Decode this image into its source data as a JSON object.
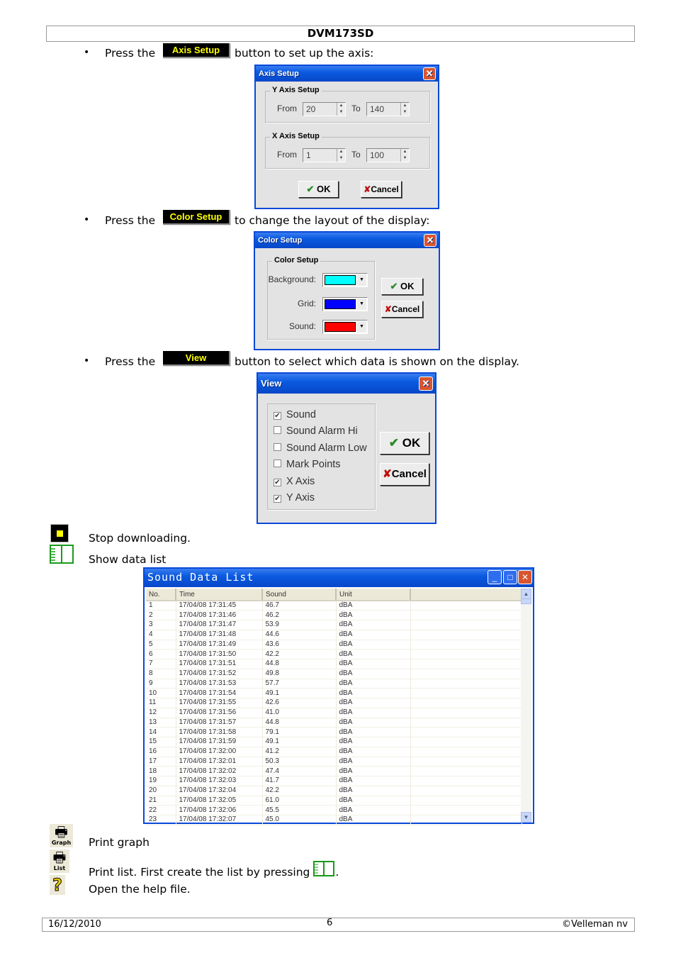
{
  "header": {
    "title": "DVM173SD"
  },
  "bullets": [
    {
      "prefix": "Press the",
      "button": "Axis Setup",
      "suffix": "button to set up the axis:"
    },
    {
      "prefix": "Press the",
      "button": "Color Setup",
      "suffix": "to change the layout of the display:"
    },
    {
      "prefix": "Press the",
      "button": "View",
      "suffix": "button to select which data is shown on the display."
    }
  ],
  "axis_dialog": {
    "title": "Axis Setup",
    "y_group": "Y Axis Setup",
    "x_group": "X Axis Setup",
    "from_label": "From",
    "to_label": "To",
    "y_from": "20",
    "y_to": "140",
    "x_from": "1",
    "x_to": "100",
    "ok": "OK",
    "cancel": "Cancel"
  },
  "color_dialog": {
    "title": "Color Setup",
    "group": "Color Setup",
    "background_label": "Background:",
    "grid_label": "Grid:",
    "sound_label": "Sound:",
    "background_color": "#00ffff",
    "grid_color": "#0000ff",
    "sound_color": "#ff0000",
    "ok": "OK",
    "cancel": "Cancel"
  },
  "view_dialog": {
    "title": "View",
    "options": [
      {
        "label": "Sound",
        "checked": true
      },
      {
        "label": "Sound Alarm Hi",
        "checked": false
      },
      {
        "label": "Sound Alarm Low",
        "checked": false
      },
      {
        "label": "Mark Points",
        "checked": false
      },
      {
        "label": "X Axis",
        "checked": true
      },
      {
        "label": "Y Axis",
        "checked": true
      }
    ],
    "ok": "OK",
    "cancel": "Cancel"
  },
  "icons": {
    "stop": "Stop downloading.",
    "show_list": "Show data list",
    "print_graph": "Print graph",
    "print_list": "Print list. First create the list by pressing",
    "print_list_end": ".",
    "help": "Open the help file.",
    "graph_caption": "Graph",
    "list_caption": "List"
  },
  "list_window": {
    "title": "Sound Data List",
    "columns": [
      "No.",
      "Time",
      "Sound",
      "Unit",
      ""
    ],
    "rows": [
      [
        "1",
        "17/04/08 17:31:45",
        "46.7",
        "dBA"
      ],
      [
        "2",
        "17/04/08 17:31:46",
        "46.2",
        "dBA"
      ],
      [
        "3",
        "17/04/08 17:31:47",
        "53.9",
        "dBA"
      ],
      [
        "4",
        "17/04/08 17:31:48",
        "44.6",
        "dBA"
      ],
      [
        "5",
        "17/04/08 17:31:49",
        "43.6",
        "dBA"
      ],
      [
        "6",
        "17/04/08 17:31:50",
        "42.2",
        "dBA"
      ],
      [
        "7",
        "17/04/08 17:31:51",
        "44.8",
        "dBA"
      ],
      [
        "8",
        "17/04/08 17:31:52",
        "49.8",
        "dBA"
      ],
      [
        "9",
        "17/04/08 17:31:53",
        "57.7",
        "dBA"
      ],
      [
        "10",
        "17/04/08 17:31:54",
        "49.1",
        "dBA"
      ],
      [
        "11",
        "17/04/08 17:31:55",
        "42.6",
        "dBA"
      ],
      [
        "12",
        "17/04/08 17:31:56",
        "41.0",
        "dBA"
      ],
      [
        "13",
        "17/04/08 17:31:57",
        "44.8",
        "dBA"
      ],
      [
        "14",
        "17/04/08 17:31:58",
        "79.1",
        "dBA"
      ],
      [
        "15",
        "17/04/08 17:31:59",
        "49.1",
        "dBA"
      ],
      [
        "16",
        "17/04/08 17:32:00",
        "41.2",
        "dBA"
      ],
      [
        "17",
        "17/04/08 17:32:01",
        "50.3",
        "dBA"
      ],
      [
        "18",
        "17/04/08 17:32:02",
        "47.4",
        "dBA"
      ],
      [
        "19",
        "17/04/08 17:32:03",
        "41.7",
        "dBA"
      ],
      [
        "20",
        "17/04/08 17:32:04",
        "42.2",
        "dBA"
      ],
      [
        "21",
        "17/04/08 17:32:05",
        "61.0",
        "dBA"
      ],
      [
        "22",
        "17/04/08 17:32:06",
        "45.5",
        "dBA"
      ],
      [
        "23",
        "17/04/08 17:32:07",
        "45.0",
        "dBA"
      ]
    ]
  },
  "footer": {
    "date": "16/12/2010",
    "page": "6",
    "copyright": "©Velleman nv"
  }
}
